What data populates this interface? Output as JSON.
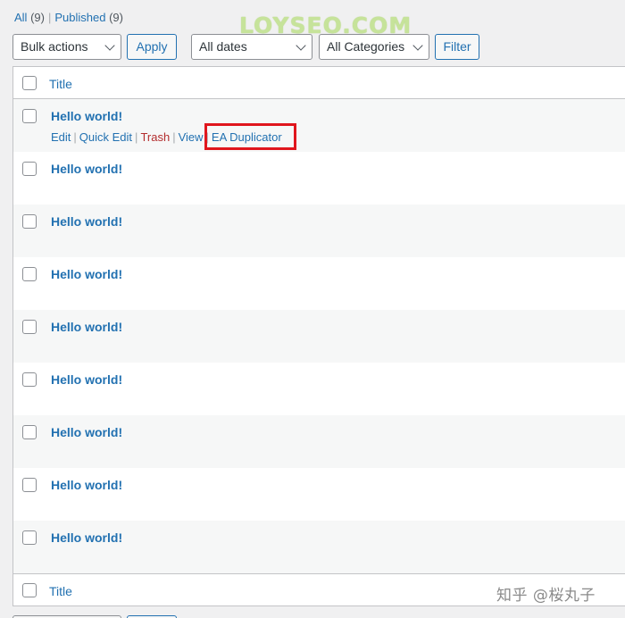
{
  "filters": {
    "all_label": "All",
    "all_count": "(9)",
    "published_label": "Published",
    "published_count": "(9)"
  },
  "watermark": "LOYSEO.COM",
  "toolbar": {
    "bulk_actions": "Bulk actions",
    "apply": "Apply",
    "dates": "All dates",
    "categories": "All Categories",
    "filter": "Filter"
  },
  "table": {
    "header_title": "Title",
    "footer_title": "Title",
    "rows": [
      {
        "title": "Hello world!"
      },
      {
        "title": "Hello world!"
      },
      {
        "title": "Hello world!"
      },
      {
        "title": "Hello world!"
      },
      {
        "title": "Hello world!"
      },
      {
        "title": "Hello world!"
      },
      {
        "title": "Hello world!"
      },
      {
        "title": "Hello world!"
      },
      {
        "title": "Hello world!"
      }
    ],
    "row_actions": {
      "edit": "Edit",
      "quick_edit": "Quick Edit",
      "trash": "Trash",
      "view": "View",
      "duplicate": "EA Duplicator",
      "separator": "|"
    }
  },
  "credit": "知乎 @桜丸子",
  "colors": {
    "link": "#2271b1",
    "trash": "#b32d2e",
    "highlight": "#e0161d"
  }
}
